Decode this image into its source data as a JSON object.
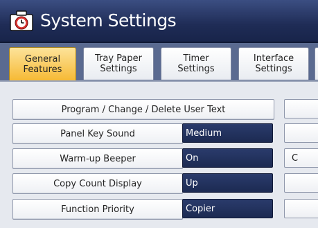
{
  "window": {
    "title": "System Settings",
    "icon": "clock-settings-icon"
  },
  "tabs": [
    {
      "line1": "General",
      "line2": "Features",
      "active": true
    },
    {
      "line1": "Tray Paper",
      "line2": "Settings",
      "active": false
    },
    {
      "line1": "Timer",
      "line2": "Settings",
      "active": false
    },
    {
      "line1": "Interface",
      "line2": "Settings",
      "active": false
    }
  ],
  "settings": {
    "program_label": "Program / Change / Delete User Text",
    "panel_key_sound": {
      "label": "Panel Key Sound",
      "value": "Medium"
    },
    "warmup_beeper": {
      "label": "Warm-up Beeper",
      "value": "On"
    },
    "copy_count_display": {
      "label": "Copy Count Display",
      "value": "Up"
    },
    "function_priority": {
      "label": "Function Priority",
      "value": "Copier"
    }
  },
  "right_column": {
    "partial_text_row2": "C"
  },
  "colors": {
    "active_tab": "#f6b933",
    "header": "#1f2c56",
    "value_bg": "#1c2a52"
  }
}
